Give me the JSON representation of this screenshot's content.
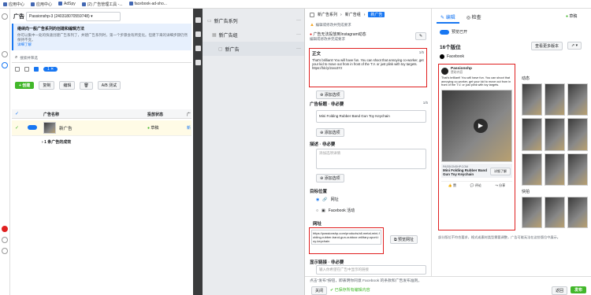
{
  "bookmarks": [
    "应用中心",
    "应用中心",
    "AdSpy",
    "(2) 广告管理工具 -...",
    "facebook-ad-sho..."
  ],
  "left": {
    "header_label": "广告",
    "account": "Passionshp-3 (240318070559748)",
    "banner_title": "继续向一般广告系列的创建和编辑方法",
    "banner_text": "你可以集中一处的快速创建广告系列了，并建广告系列时，第一个步骤会有所变化。但建下来的详细步骤仍然保持不变。",
    "banner_link": "详细了解",
    "search_placeholder": "搜索并筛选",
    "filter_chip": "1",
    "create_label": "+ 创建",
    "copy_label": "复制",
    "edit_label": "编辑",
    "ab_label": "A/B 测试",
    "col_name": "广告名称",
    "col_status": "投放状态",
    "col_extra": "广",
    "row_name": "新广告",
    "row_status": "草稿",
    "row_extra": "新",
    "summary": "1 条广告的成效"
  },
  "tree": {
    "campaign": "新广告系列",
    "adset": "新广告组",
    "ad": "新广告"
  },
  "breadcrumb": [
    "新广告系列",
    "新广告组",
    "新广告"
  ],
  "tabs": {
    "edit": "编辑",
    "review": "检查"
  },
  "top_right": {
    "status": "草稿"
  },
  "form": {
    "notice1": "编辑或修改并完成要求",
    "notice2": "广告无法投放到Instagram动态",
    "notice2b": "编辑或修改并完成要求",
    "primary_label": "正文",
    "primary_count": "1/5",
    "primary_text": "That's brilliant! You will have fun. You can shoot that annoying co-worker, get your kid to move out from in front of the T.V. or just plink with toy targets. https://bit.ly/2ovx3Yz",
    "add_option1": "添加选项",
    "headline_label": "广告标题 · 非必要",
    "headline_count": "1/5",
    "headline_value": "Mini Folding Rubber Band Gun Toy Keychain",
    "add_option2": "添加选项",
    "desc_label": "描述 · 非必要",
    "desc_placeholder": "添加选项详情",
    "add_option3": "添加选项",
    "dest_label": "目标位置",
    "dest_website": "网址",
    "dest_event": "Facebook 活动",
    "url_label": "网址",
    "url_value": "https://passionshp.com/products/all-metal-mini-folding-rubber-band-gun-outdoor-military-sport-toy-keychain",
    "preview_url": "预览网址",
    "display_label": "显示链接 · 非必要",
    "display_placeholder": "输入你希望在广告中显示的链接"
  },
  "preview": {
    "toggle_label": "预览已开",
    "placements": "16个版位",
    "view_all": "查看更多版本",
    "facebook": "Facebook",
    "feed_label": "动态",
    "video_label": "快拍",
    "page_name": "Passionshp",
    "sponsored": "赞助内容",
    "ad_text": "That's brilliant! You will have fun. You can shoot that annoying co-worker, get your kid to move out from in front of the T.V. or just plink with toy targets.",
    "site": "PASSIONSHP.COM",
    "headline": "Mini Folding Rubber Band Gun Toy Keychain",
    "cta": "详细了解",
    "actions": [
      "赞",
      "评论",
      "分享"
    ],
    "warning": "部分版位不符合要求，格式或素材类型需要调整，广告可能无法在这些版位中展示。"
  },
  "footer": {
    "notice": "点击\"发布\"按钮，即表明你同意 Facebook 的条款和广告发布准则。",
    "close": "关闭",
    "saved": "已保存所有编辑内容",
    "back": "返回",
    "publish": "发布"
  },
  "colors": {
    "accent": "#1877f2",
    "publish": "#42b72a",
    "red": "#e02020",
    "dark_rail": "#3a3b3c"
  }
}
